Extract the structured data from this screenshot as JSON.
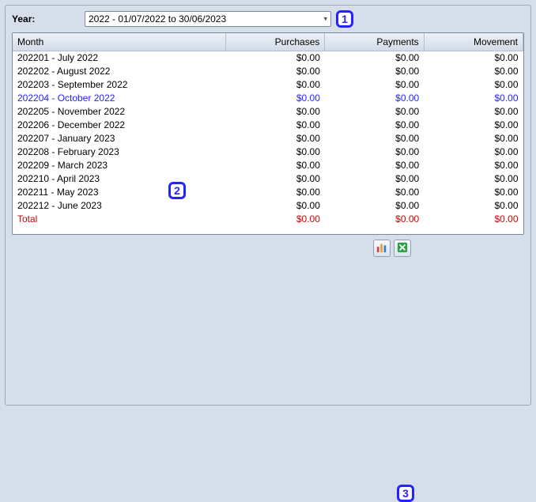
{
  "year": {
    "label": "Year:",
    "selected": "2022 - 01/07/2022 to 30/06/2023"
  },
  "badges": {
    "b1": "1",
    "b2": "2",
    "b3": "3"
  },
  "table": {
    "headers": {
      "month": "Month",
      "purchases": "Purchases",
      "payments": "Payments",
      "movement": "Movement"
    },
    "rows": [
      {
        "month": "202201 - July 2022",
        "purchases": "$0.00",
        "payments": "$0.00",
        "movement": "$0.00",
        "highlight": false
      },
      {
        "month": "202202 - August 2022",
        "purchases": "$0.00",
        "payments": "$0.00",
        "movement": "$0.00",
        "highlight": false
      },
      {
        "month": "202203 - September 2022",
        "purchases": "$0.00",
        "payments": "$0.00",
        "movement": "$0.00",
        "highlight": false
      },
      {
        "month": "202204 - October 2022",
        "purchases": "$0.00",
        "payments": "$0.00",
        "movement": "$0.00",
        "highlight": true
      },
      {
        "month": "202205 - November 2022",
        "purchases": "$0.00",
        "payments": "$0.00",
        "movement": "$0.00",
        "highlight": false
      },
      {
        "month": "202206 - December 2022",
        "purchases": "$0.00",
        "payments": "$0.00",
        "movement": "$0.00",
        "highlight": false
      },
      {
        "month": "202207 - January 2023",
        "purchases": "$0.00",
        "payments": "$0.00",
        "movement": "$0.00",
        "highlight": false
      },
      {
        "month": "202208 - February 2023",
        "purchases": "$0.00",
        "payments": "$0.00",
        "movement": "$0.00",
        "highlight": false
      },
      {
        "month": "202209 - March 2023",
        "purchases": "$0.00",
        "payments": "$0.00",
        "movement": "$0.00",
        "highlight": false
      },
      {
        "month": "202210 - April 2023",
        "purchases": "$0.00",
        "payments": "$0.00",
        "movement": "$0.00",
        "highlight": false
      },
      {
        "month": "202211 - May 2023",
        "purchases": "$0.00",
        "payments": "$0.00",
        "movement": "$0.00",
        "highlight": false
      },
      {
        "month": "202212 - June 2023",
        "purchases": "$0.00",
        "payments": "$0.00",
        "movement": "$0.00",
        "highlight": false
      }
    ],
    "total": {
      "label": "Total",
      "purchases": "$0.00",
      "payments": "$0.00",
      "movement": "$0.00"
    }
  }
}
